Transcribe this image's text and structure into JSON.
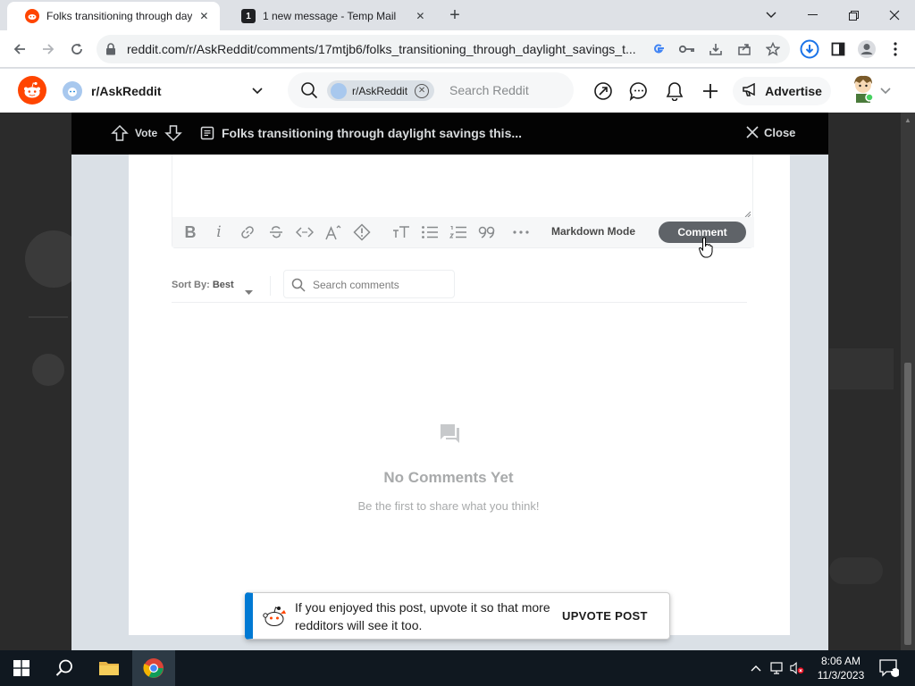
{
  "browser": {
    "tabs": [
      {
        "title": "Folks transitioning through dayli",
        "active": true,
        "favicon": "reddit-favicon"
      },
      {
        "title": "1 new message - Temp Mail",
        "active": false,
        "favicon": "tempmail-favicon",
        "favicon_text": "1"
      }
    ],
    "address": "reddit.com/r/AskReddit/comments/17mtjb6/folks_transitioning_through_daylight_savings_t...",
    "colors": {
      "chrome_bg": "#dee1e6",
      "toolbar_bg": "#ffffff",
      "accent_download": "#1a73e8"
    }
  },
  "reddit_header": {
    "subreddit": "r/AskReddit",
    "search": {
      "chip": "r/AskReddit",
      "placeholder": "Search Reddit"
    },
    "advertise_label": "Advertise",
    "brand_color": "#ff4500"
  },
  "post_bar": {
    "vote_label": "Vote",
    "title": "Folks transitioning through daylight savings this...",
    "close_label": "Close"
  },
  "editor": {
    "toolbar_icons": [
      "bold-icon",
      "italic-icon",
      "link-icon",
      "strikethrough-icon",
      "inline-code-icon",
      "superscript-icon",
      "spoiler-icon",
      "heading-icon",
      "bulleted-list-icon",
      "numbered-list-icon",
      "quote-block-icon",
      "more-icon"
    ],
    "markdown_mode_label": "Markdown Mode",
    "comment_button_label": "Comment"
  },
  "comments": {
    "sort_label": "Sort By:",
    "sort_value": "Best",
    "search_placeholder": "Search comments",
    "empty_title": "No Comments Yet",
    "empty_subtitle": "Be the first to share what you think!"
  },
  "toast": {
    "message": "If you enjoyed this post, upvote it so that more redditors will see it too.",
    "action": "UPVOTE POST",
    "accent_color": "#0079d3"
  },
  "taskbar": {
    "time": "8:06 AM",
    "date": "11/3/2023",
    "notification_count": "2"
  }
}
